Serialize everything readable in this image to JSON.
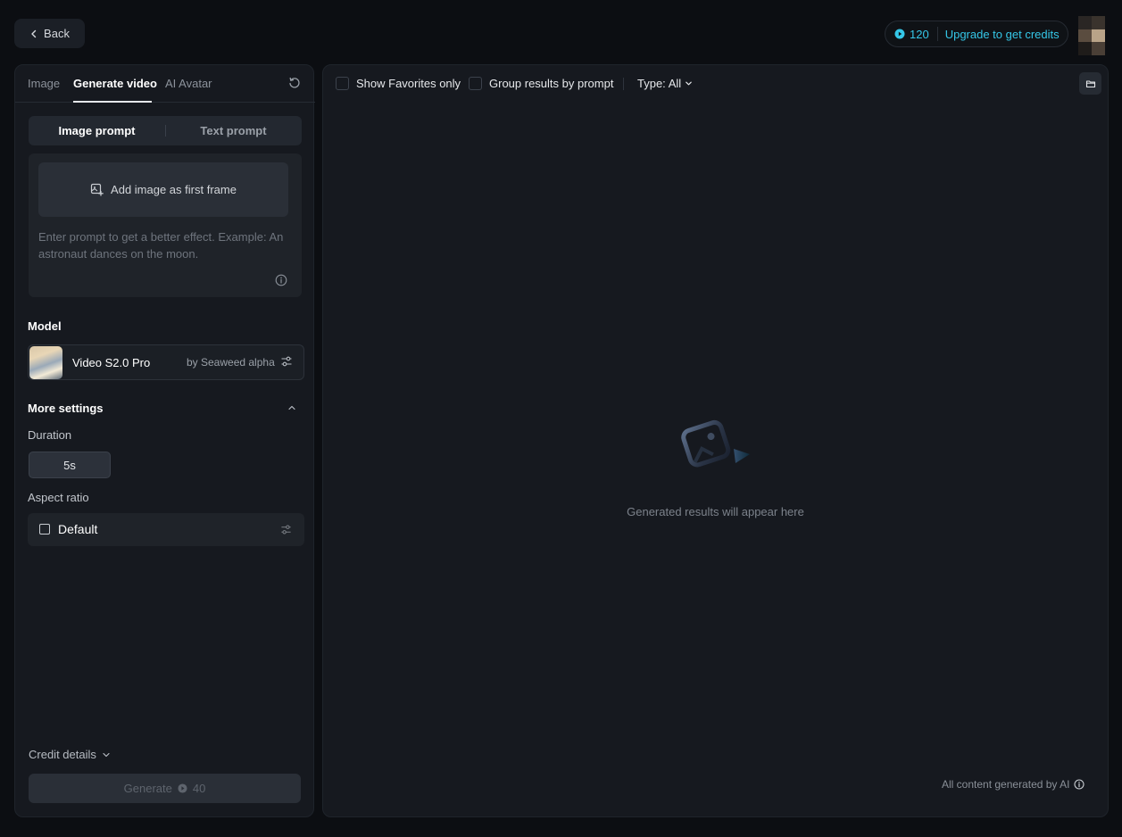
{
  "topbar": {
    "back_label": "Back",
    "credits_count": "120",
    "upgrade_label": "Upgrade to get credits"
  },
  "colors": {
    "accent": "#35c7e8",
    "panel_bg": "#16191f",
    "page_bg": "#0c0e12"
  },
  "left": {
    "tabs": [
      {
        "label": "Image",
        "active": false
      },
      {
        "label": "Generate video",
        "active": true
      },
      {
        "label": "AI Avatar",
        "active": false
      }
    ],
    "prompt_modes": [
      {
        "label": "Image prompt",
        "active": true
      },
      {
        "label": "Text prompt",
        "active": false
      }
    ],
    "add_frame_label": "Add image as first frame",
    "prompt_placeholder": "Enter prompt to get a better effect. Example: An astronaut dances on the moon.",
    "model_title": "Model",
    "model": {
      "name": "Video S2.0 Pro",
      "by": "by Seaweed alpha"
    },
    "more_settings_title": "More settings",
    "duration_label": "Duration",
    "duration_value": "5s",
    "aspect_label": "Aspect ratio",
    "aspect_value": "Default",
    "credit_details_label": "Credit details",
    "generate_label": "Generate",
    "generate_cost": "40"
  },
  "main": {
    "filters": {
      "favorites_label": "Show Favorites only",
      "group_label": "Group results by prompt",
      "type_label": "Type: All"
    },
    "empty_text": "Generated results will appear here",
    "ai_note": "All content generated by AI"
  },
  "icons": {
    "back": "chevron-left-icon",
    "credits": "play-circle-icon",
    "refresh": "refresh-icon",
    "add_frame": "image-plus-icon",
    "info": "info-icon",
    "settings": "sliders-icon",
    "folder": "folder-icon"
  }
}
